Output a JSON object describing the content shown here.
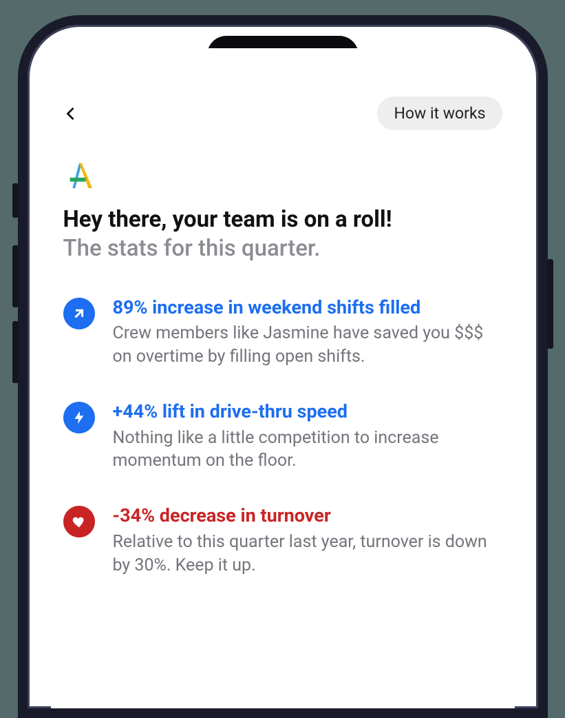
{
  "topbar": {
    "how_it_works_label": "How it works"
  },
  "headline": "Hey there, your team is on a roll!",
  "subhead": "The stats for this quarter.",
  "stats": [
    {
      "icon": "arrow-up-right",
      "color": "blue",
      "title": "89% increase in weekend shifts filled",
      "desc": "Crew members like Jasmine have saved you $$$ on overtime by filling open shifts."
    },
    {
      "icon": "bolt",
      "color": "blue",
      "title": "+44% lift in drive-thru speed",
      "desc": "Nothing like a little competition to increase momentum on the floor."
    },
    {
      "icon": "heart",
      "color": "red",
      "title": "-34% decrease in turnover",
      "desc": "Relative to this quarter last year, turnover is down by 30%. Keep it up."
    }
  ]
}
